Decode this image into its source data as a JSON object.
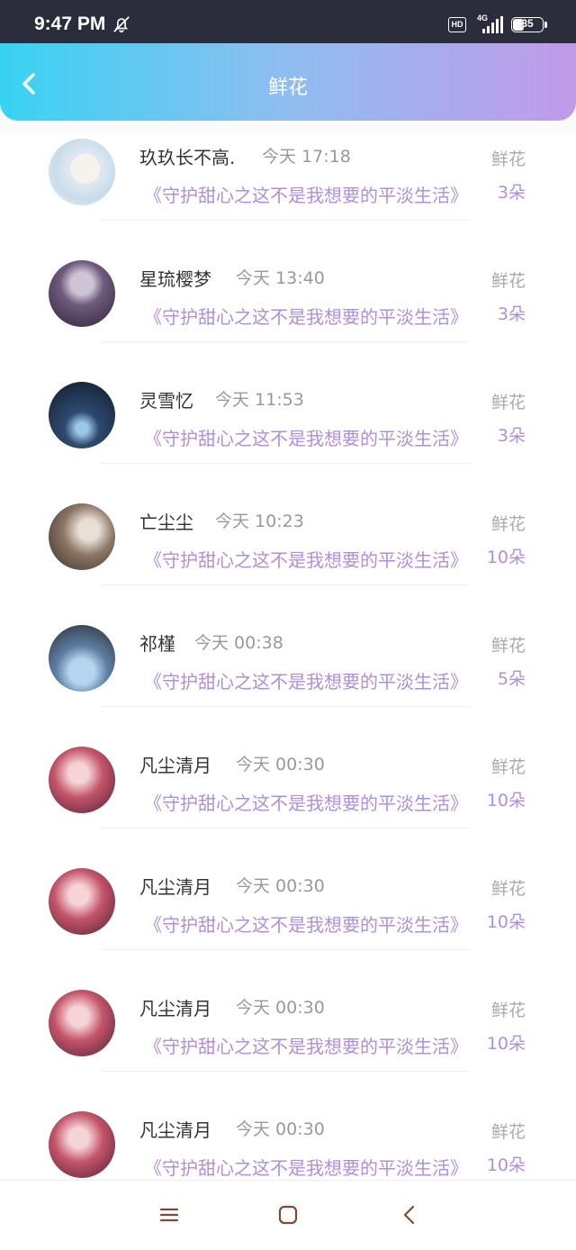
{
  "status_bar": {
    "time": "9:47 PM",
    "hd": "HD",
    "network": "4G",
    "battery": "35"
  },
  "header": {
    "title": "鲜花"
  },
  "rows": [
    {
      "name": "玖玖长不高.",
      "time": "今天 17:18",
      "book": "《守护甜心之这不是我想要的平淡生活》",
      "label": "鲜花",
      "count": "3朵"
    },
    {
      "name": "星琉樱梦",
      "time": "今天 13:40",
      "book": "《守护甜心之这不是我想要的平淡生活》",
      "label": "鲜花",
      "count": "3朵"
    },
    {
      "name": "灵雪忆",
      "time": "今天 11:53",
      "book": "《守护甜心之这不是我想要的平淡生活》",
      "label": "鲜花",
      "count": "3朵"
    },
    {
      "name": "亡尘尘",
      "time": "今天 10:23",
      "book": "《守护甜心之这不是我想要的平淡生活》",
      "label": "鲜花",
      "count": "10朵"
    },
    {
      "name": "祁槿",
      "time": "今天 00:38",
      "book": "《守护甜心之这不是我想要的平淡生活》",
      "label": "鲜花",
      "count": "5朵"
    },
    {
      "name": "凡尘清月",
      "time": "今天 00:30",
      "book": "《守护甜心之这不是我想要的平淡生活》",
      "label": "鲜花",
      "count": "10朵"
    },
    {
      "name": "凡尘清月",
      "time": "今天 00:30",
      "book": "《守护甜心之这不是我想要的平淡生活》",
      "label": "鲜花",
      "count": "10朵"
    },
    {
      "name": "凡尘清月",
      "time": "今天 00:30",
      "book": "《守护甜心之这不是我想要的平淡生活》",
      "label": "鲜花",
      "count": "10朵"
    },
    {
      "name": "凡尘清月",
      "time": "今天 00:30",
      "book": "《守护甜心之这不是我想要的平淡生活》",
      "label": "鲜花",
      "count": "10朵"
    }
  ],
  "colors": {
    "accent": "#b08fd9",
    "gradient_start": "#38d3f2",
    "gradient_end": "#c19ae8"
  }
}
